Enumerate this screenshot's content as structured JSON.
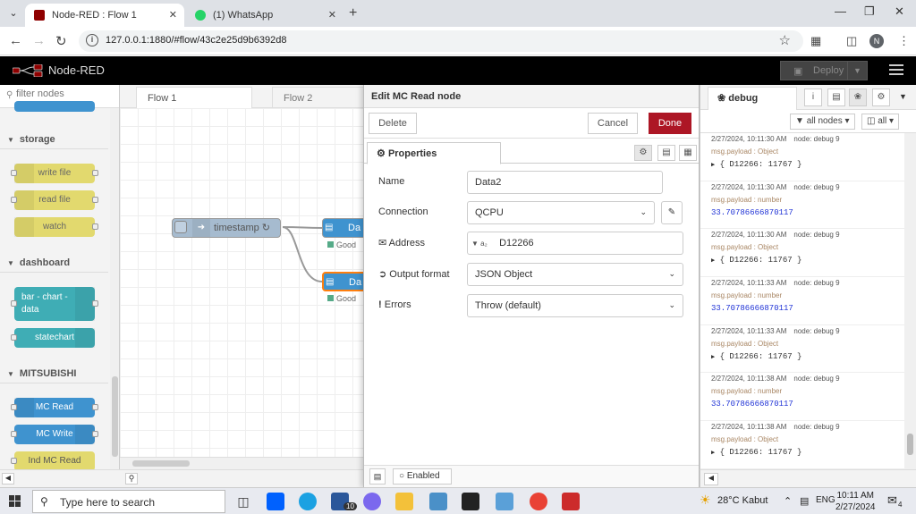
{
  "browser": {
    "tabs": [
      {
        "title": "Node-RED : Flow 1",
        "active": true
      },
      {
        "title": "(1) WhatsApp",
        "active": false
      }
    ],
    "url": "127.0.0.1:1880/#flow/43c2e25d9b6392d8",
    "profile_initial": "N"
  },
  "header": {
    "title": "Node-RED",
    "deploy_label": "Deploy"
  },
  "palette": {
    "search_placeholder": "filter nodes",
    "categories": [
      {
        "name": "storage",
        "nodes": [
          "write file",
          "read file",
          "watch"
        ]
      },
      {
        "name": "dashboard",
        "nodes": [
          "bar - chart - data",
          "statechart"
        ]
      },
      {
        "name": "MITSUBISHI",
        "nodes": [
          "MC Read",
          "MC Write",
          "Ind MC Read"
        ]
      }
    ]
  },
  "workspace": {
    "tabs": [
      "Flow 1",
      "Flow 2"
    ],
    "nodes": [
      {
        "label": "timestamp ↻"
      },
      {
        "label": "Da",
        "status": "Good"
      },
      {
        "label": "Da",
        "status": "Good"
      }
    ]
  },
  "editor": {
    "title": "Edit MC Read node",
    "delete_label": "Delete",
    "cancel_label": "Cancel",
    "done_label": "Done",
    "tab_label": "Properties",
    "fields": {
      "name": {
        "label": "Name",
        "value": "Data2"
      },
      "connection": {
        "label": "Connection",
        "value": "QCPU"
      },
      "address": {
        "label": "Address",
        "value": "D12266"
      },
      "output_format": {
        "label": "Output format",
        "value": "JSON Object"
      },
      "errors": {
        "label": "Errors",
        "value": "Throw (default)"
      }
    },
    "enabled_label": "Enabled"
  },
  "sidebar": {
    "tab_label": "debug",
    "filter_nodes": "all nodes",
    "clear_label": "all",
    "messages": [
      {
        "time": "2/27/2024, 10:11:30 AM",
        "node": "node: debug 9",
        "topic": "msg.payload : Object",
        "value": "{ D12266: 11767 }",
        "kind": "object"
      },
      {
        "time": "2/27/2024, 10:11:30 AM",
        "node": "node: debug 9",
        "topic": "msg.payload : number",
        "value": "33.70786666870117",
        "kind": "number"
      },
      {
        "time": "2/27/2024, 10:11:30 AM",
        "node": "node: debug 9",
        "topic": "msg.payload : Object",
        "value": "{ D12266: 11767 }",
        "kind": "object"
      },
      {
        "time": "2/27/2024, 10:11:33 AM",
        "node": "node: debug 9",
        "topic": "msg.payload : number",
        "value": "33.70786666870117",
        "kind": "number"
      },
      {
        "time": "2/27/2024, 10:11:33 AM",
        "node": "node: debug 9",
        "topic": "msg.payload : Object",
        "value": "{ D12266: 11767 }",
        "kind": "object"
      },
      {
        "time": "2/27/2024, 10:11:38 AM",
        "node": "node: debug 9",
        "topic": "msg.payload : number",
        "value": "33.70786666870117",
        "kind": "number"
      },
      {
        "time": "2/27/2024, 10:11:38 AM",
        "node": "node: debug 9",
        "topic": "msg.payload : Object",
        "value": "{ D12266: 11767 }",
        "kind": "object"
      }
    ]
  },
  "taskbar": {
    "search_placeholder": "Type here to search",
    "badge_count": "10",
    "weather": "28°C  Kabut",
    "language": "ENG",
    "time": "10:11 AM",
    "date": "2/27/2024",
    "notification_count": "4"
  },
  "colors": {
    "accent": "#AD1625",
    "storage_node": "#E2D96E",
    "dashboard_node": "#3FADB5",
    "mitsubishi_node": "#3f93cf"
  }
}
